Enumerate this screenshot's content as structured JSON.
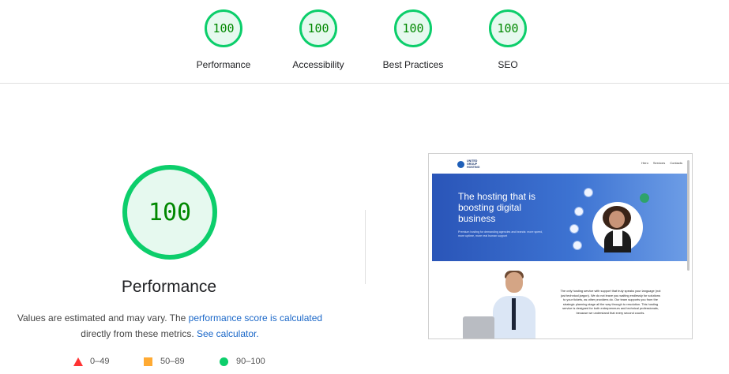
{
  "summary": {
    "categories": [
      {
        "score": "100",
        "label": "Performance"
      },
      {
        "score": "100",
        "label": "Accessibility"
      },
      {
        "score": "100",
        "label": "Best Practices"
      },
      {
        "score": "100",
        "label": "SEO"
      }
    ]
  },
  "performance": {
    "score": "100",
    "title": "Performance",
    "desc_prefix": "Values are estimated and may vary. The ",
    "desc_link": "performance score is calculated",
    "desc_middle": " directly from these metrics. ",
    "desc_calculator": "See calculator.",
    "legend": {
      "fail": "0–49",
      "average": "50–89",
      "pass": "90–100"
    }
  },
  "colors": {
    "pass": "#0cce6b",
    "average": "#ffaa33",
    "fail": "#ff3333",
    "link": "#1a67c8"
  },
  "screenshot": {
    "logo_lines": [
      "UNITED",
      "GROUP",
      "HOSTING"
    ],
    "nav_links": [
      "Hero",
      "Services",
      "Contacts"
    ],
    "hero_title": "The hosting that is boosting digital business",
    "hero_subtitle": "Premium hosting for demanding agencies and brands: more speed, more uptime, more real human support",
    "body_text": "The only hosting service with support that truly speaks your language (not just technical jargon). We do not leave you waiting endlessly for solutions to your tickets, as other providers do. Our team supports you from the strategic planning stage all the way through to resolution. This hosting service is designed for both entrepreneurs and technical professionals, because we understand that every second counts."
  }
}
